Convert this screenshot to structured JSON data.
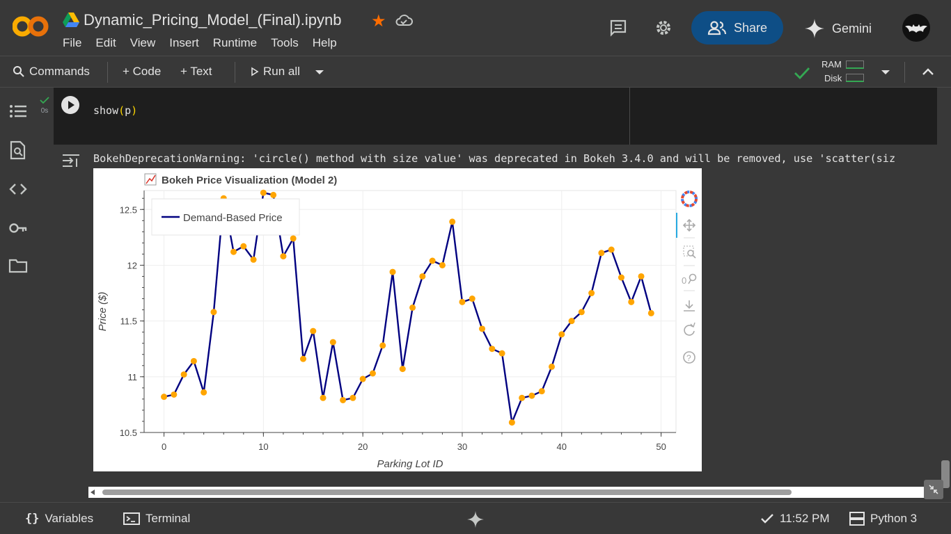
{
  "header": {
    "title": "Dynamic_Pricing_Model_(Final).ipynb",
    "menu": [
      "File",
      "Edit",
      "View",
      "Insert",
      "Runtime",
      "Tools",
      "Help"
    ],
    "share_label": "Share",
    "gemini_label": "Gemini"
  },
  "toolbar": {
    "commands_label": "Commands",
    "code_label": "+ Code",
    "text_label": "+ Text",
    "run_all_label": "Run all",
    "ram_label": "RAM",
    "disk_label": "Disk"
  },
  "cell": {
    "exec_time": "0s",
    "code_fn": "show",
    "code_arg": "p",
    "warning": "BokehDeprecationWarning: 'circle() method with size value' was deprecated in Bokeh 3.4.0 and will be removed, use 'scatter(siz"
  },
  "footer": {
    "variables_label": "Variables",
    "terminal_label": "Terminal",
    "time": "11:52 PM",
    "runtime_label": "Python 3"
  },
  "colors": {
    "accent": "#0e4e86",
    "line": "#000080",
    "marker": "#ffa500",
    "status_ok": "#34a853",
    "star": "#ff6d00"
  },
  "chart_data": {
    "type": "line",
    "title": "Bokeh Price Visualization (Model 2)",
    "xlabel": "Parking Lot ID",
    "ylabel": "Price ($)",
    "legend": "Demand-Based Price",
    "legend_position": "top-left",
    "xlim": [
      -2,
      51.5
    ],
    "ylim": [
      10.5,
      12.67
    ],
    "xticks": [
      0,
      10,
      20,
      30,
      40,
      50
    ],
    "yticks": [
      10.5,
      11,
      11.5,
      12,
      12.5
    ],
    "ytick_labels": [
      "10.5",
      "11",
      "11.5",
      "12",
      "12.5"
    ],
    "x": [
      0,
      1,
      2,
      3,
      4,
      5,
      6,
      7,
      8,
      9,
      10,
      11,
      12,
      13,
      14,
      15,
      16,
      17,
      18,
      19,
      20,
      21,
      22,
      23,
      24,
      25,
      26,
      27,
      28,
      29,
      30,
      31,
      32,
      33,
      34,
      35,
      36,
      37,
      38,
      39,
      40,
      41,
      42,
      43,
      44,
      45,
      46,
      47,
      48,
      49
    ],
    "y": [
      10.82,
      10.84,
      11.02,
      11.14,
      10.86,
      11.58,
      12.6,
      12.12,
      12.17,
      12.05,
      12.65,
      12.63,
      12.08,
      12.24,
      11.16,
      11.41,
      10.81,
      11.31,
      10.79,
      10.81,
      10.98,
      11.03,
      11.28,
      11.94,
      11.07,
      11.62,
      11.9,
      12.04,
      12.0,
      12.39,
      11.67,
      11.7,
      11.43,
      11.25,
      11.21,
      10.59,
      10.81,
      10.83,
      10.87,
      11.09,
      11.38,
      11.5,
      11.58,
      11.75,
      12.11,
      12.14,
      11.89,
      11.67,
      11.9,
      11.57
    ]
  }
}
